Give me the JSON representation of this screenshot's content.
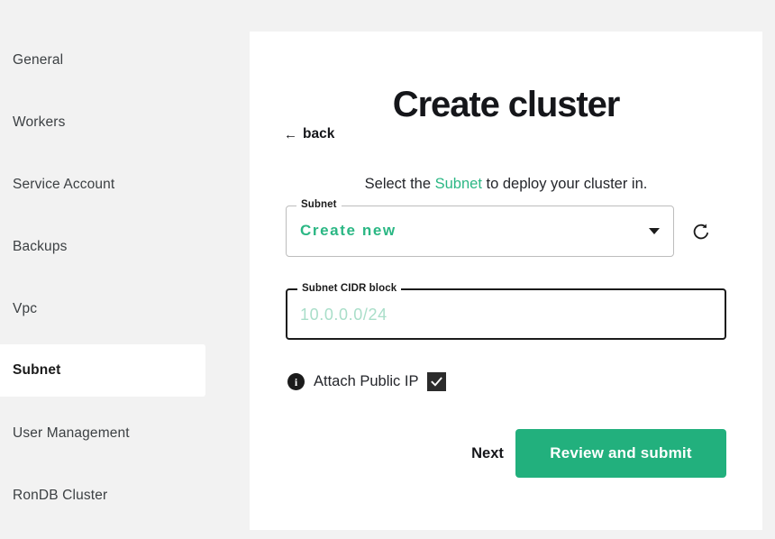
{
  "theme": {
    "page_background": "#f2f2f2",
    "card_background": "#ffffff",
    "accent_green": "#22b07d",
    "placeholder_green": "#a9dec9",
    "text_dark": "#15161a"
  },
  "sidebar": {
    "items": [
      {
        "label": "General",
        "active": false
      },
      {
        "label": "Workers",
        "active": false
      },
      {
        "label": "Service Account",
        "active": false
      },
      {
        "label": "Backups",
        "active": false
      },
      {
        "label": "Vpc",
        "active": false
      },
      {
        "label": "Subnet",
        "active": true
      },
      {
        "label": "User Management",
        "active": false
      },
      {
        "label": "RonDB Cluster",
        "active": false
      }
    ]
  },
  "main": {
    "title": "Create cluster",
    "back_link": {
      "arrow": "←",
      "label": "back"
    },
    "subtitle": {
      "prefix": "Select the ",
      "highlight": "Subnet",
      "suffix": " to deploy your cluster in."
    },
    "subnet_select": {
      "legend": "Subnet",
      "value": "Create new",
      "caret_icon": "chevron-down-icon"
    },
    "refresh_button": {
      "icon": "refresh-icon"
    },
    "cidr_input": {
      "legend": "Subnet CIDR block",
      "value": "",
      "placeholder": "10.0.0.0/24"
    },
    "attach_public_ip": {
      "info_icon": "info-icon",
      "info_glyph": "i",
      "label": "Attach Public IP",
      "checked": true,
      "check_glyph": "✓"
    },
    "buttons": {
      "next": "Next",
      "submit": "Review and submit"
    }
  }
}
